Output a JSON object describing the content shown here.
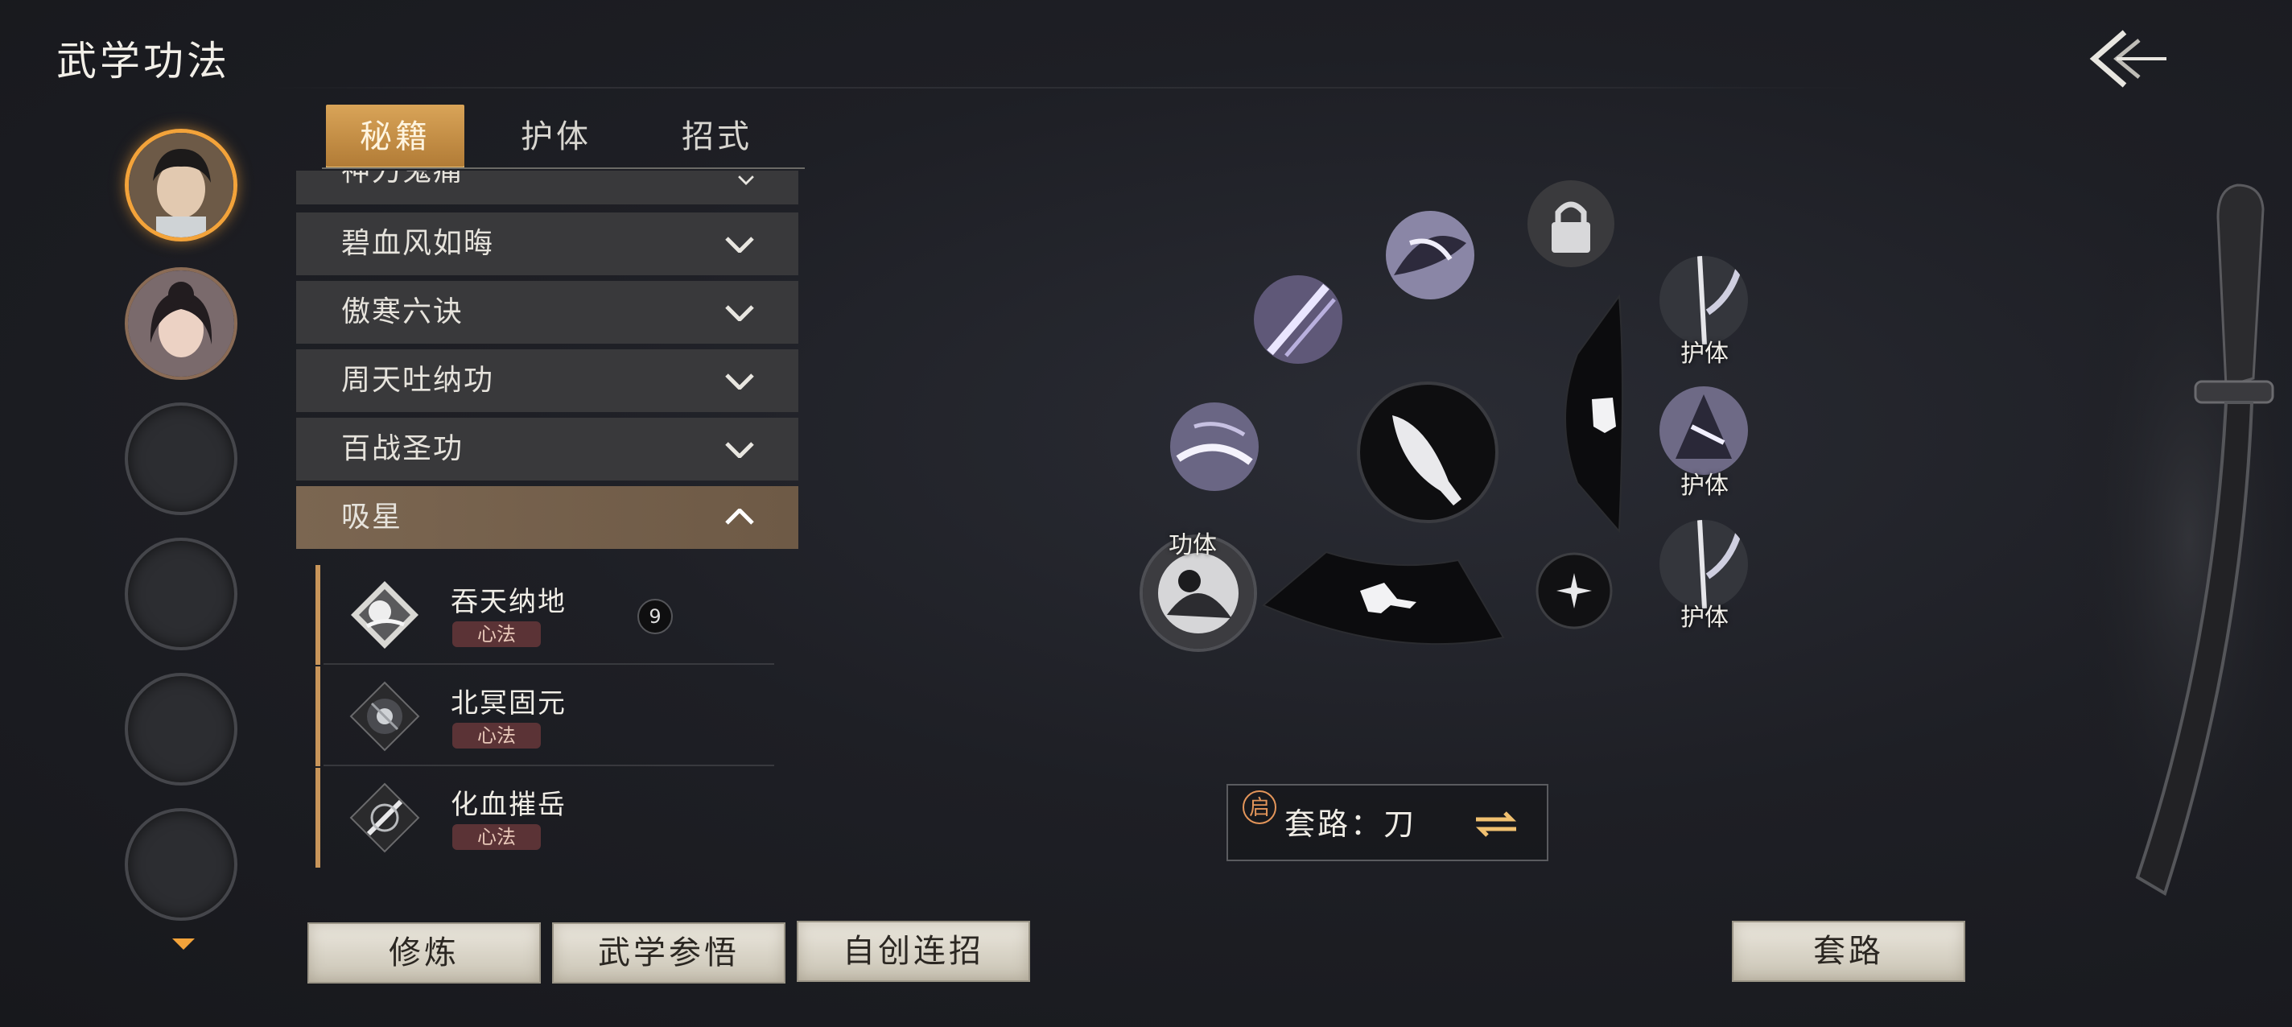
{
  "header": {
    "title": "武学功法",
    "back_icon": "back-arrow-icon"
  },
  "tabs": [
    {
      "label": "秘籍",
      "active": true
    },
    {
      "label": "护体",
      "active": false
    },
    {
      "label": "招式",
      "active": false
    }
  ],
  "categories": {
    "partial": "神刀鬼痛",
    "c1": "碧血风如晦",
    "c2": "傲寒六诀",
    "c3": "周天吐纳功",
    "c4": "百战圣功",
    "c5": "吸星"
  },
  "items": [
    {
      "name": "吞天纳地",
      "tag": "心法",
      "badge": "9"
    },
    {
      "name": "北冥固元",
      "tag": "心法"
    },
    {
      "name": "化血摧岳",
      "tag": "心法"
    }
  ],
  "wheel": {
    "label_gongti": "功体",
    "label_huti_1": "护体",
    "label_huti_2": "护体",
    "label_huti_3": "护体"
  },
  "route": {
    "badge": "启",
    "text": "套路：刀"
  },
  "buttons": {
    "practice": "修炼",
    "comprehend": "武学参悟",
    "custom_combo": "自创连招",
    "route": "套路"
  },
  "colors": {
    "accent": "#f3a33a",
    "tab_active": "#c89048",
    "tag_bg": "#5b3336"
  }
}
